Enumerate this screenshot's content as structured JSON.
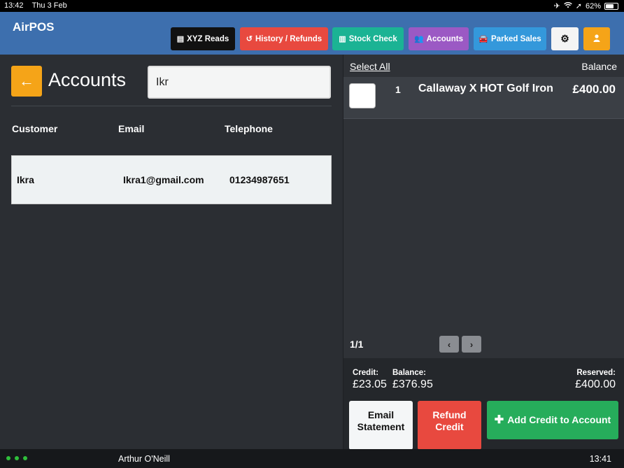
{
  "status_bar": {
    "time": "13:42",
    "date": "Thu 3 Feb",
    "battery": "62%"
  },
  "header": {
    "app_title": "AirPOS",
    "buttons": {
      "xyz_reads": "XYZ Reads",
      "history": "History / Refunds",
      "stock_check": "Stock Check",
      "accounts": "Accounts",
      "parked_sales": "Parked Sales"
    },
    "colors": {
      "xyz": "#111111",
      "history": "#e8493f",
      "stock": "#1bb394",
      "accounts": "#9b59c4",
      "parked": "#3498db",
      "settings": "#f4f4f4",
      "user": "#f5a418"
    }
  },
  "accounts_panel": {
    "back_arrow": "←",
    "title": "Accounts",
    "search_value": "Ikr",
    "columns": {
      "customer": "Customer",
      "email": "Email",
      "telephone": "Telephone"
    },
    "rows": [
      {
        "customer": "Ikra",
        "email": "Ikra1@gmail.com",
        "telephone": "01234987651"
      }
    ]
  },
  "balance_panel": {
    "select_all": "Select All",
    "balance_header": "Balance",
    "items": [
      {
        "qty": "1",
        "name": "Callaway X HOT Golf Iron",
        "price": "£400.00"
      }
    ],
    "page_indicator": "1/1",
    "credit_label": "Credit:",
    "credit_value": "£23.05",
    "balance_label": "Balance:",
    "balance_value": "£376.95",
    "reserved_label": "Reserved:",
    "reserved_value": "£400.00",
    "actions": {
      "email_statement": "Email\nStatement",
      "refund_credit": "Refund\nCredit",
      "add_credit": "Add Credit to Account"
    }
  },
  "bottom_bar": {
    "user_name": "Arthur O'Neill",
    "time": "13:41"
  }
}
